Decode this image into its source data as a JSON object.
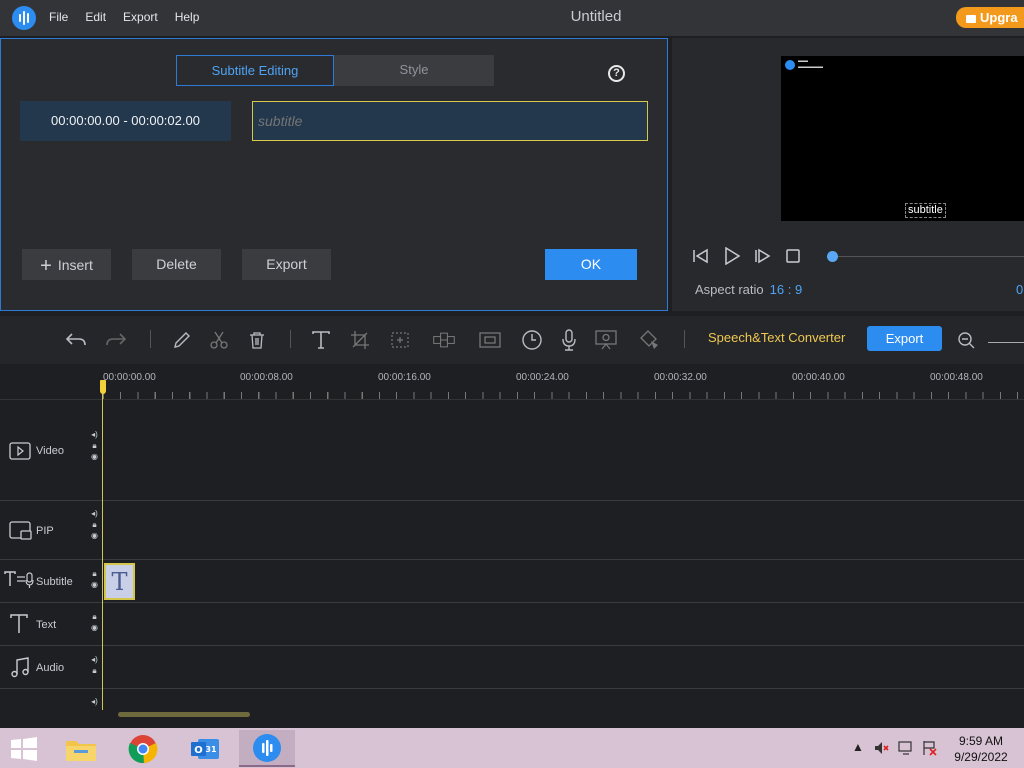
{
  "app": {
    "title": "Untitled",
    "menu": [
      "File",
      "Edit",
      "Export",
      "Help"
    ],
    "upgrade_label": "Upgra"
  },
  "subtitle_panel": {
    "tabs": [
      "Subtitle Editing",
      "Style"
    ],
    "active_tab": "Subtitle Editing",
    "time_range": "00:00:00.00 - 00:00:02.00",
    "subtitle_placeholder": "subtitle",
    "buttons": {
      "insert": "Insert",
      "delete": "Delete",
      "export": "Export",
      "ok": "OK"
    },
    "help_glyph": "?"
  },
  "preview": {
    "screen_text": "subtitle",
    "aspect_label": "Aspect ratio",
    "aspect_value": "16 : 9",
    "right_value": "0",
    "progress": 0
  },
  "toolbar": {
    "speech_text": "Speech&Text Converter",
    "export_label": "Export"
  },
  "timeline": {
    "ruler": [
      "00:00:00.00",
      "00:00:08.00",
      "00:00:16.00",
      "00:00:24.00",
      "00:00:32.00",
      "00:00:40.00",
      "00:00:48.00"
    ],
    "tracks": {
      "video": "Video",
      "pip": "PIP",
      "subtitle": "Subtitle",
      "text": "Text",
      "audio": "Audio"
    },
    "clip_glyph": "T"
  },
  "taskbar": {
    "time": "9:59 AM",
    "date": "9/29/2022"
  },
  "colors": {
    "accent": "#2d8cf0",
    "highlight": "#d4c64a",
    "upgrade": "#f39a1d"
  }
}
